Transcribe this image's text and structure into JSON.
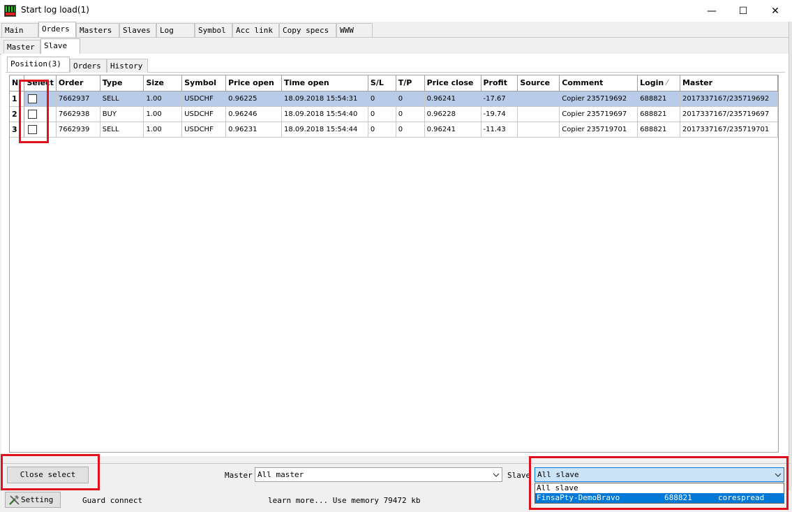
{
  "window": {
    "title": "Start log load(1)",
    "minimize": "—",
    "maximize": "☐",
    "close": "✕"
  },
  "main_tabs": [
    "Main",
    "Orders",
    "Masters",
    "Slaves",
    "Log",
    "Symbol",
    "Acc link",
    "Copy specs",
    "WWW"
  ],
  "sub_tabs": [
    "Master",
    "Slave"
  ],
  "inner_tabs": [
    "Position(3)",
    "Orders",
    "History"
  ],
  "table": {
    "columns": [
      "N",
      "Select",
      "Order",
      "Type",
      "Size",
      "Symbol",
      "Price open",
      "Time open",
      "S/L",
      "T/P",
      "Price close",
      "Profit",
      "Source",
      "Comment",
      "Login",
      "Master"
    ],
    "sort_indicator": "⁄",
    "rows": [
      {
        "n": "1",
        "order": "7662937",
        "type": "SELL",
        "size": "1.00",
        "symbol": "USDCHF",
        "price_open": "0.96225",
        "time_open": "18.09.2018 15:54:31",
        "sl": "0",
        "tp": "0",
        "price_close": "0.96241",
        "profit": "-17.67",
        "source": "",
        "comment": "Copier 235719692",
        "login": "688821",
        "master": "2017337167/235719692"
      },
      {
        "n": "2",
        "order": "7662938",
        "type": "BUY",
        "size": "1.00",
        "symbol": "USDCHF",
        "price_open": "0.96246",
        "time_open": "18.09.2018 15:54:40",
        "sl": "0",
        "tp": "0",
        "price_close": "0.96228",
        "profit": "-19.74",
        "source": "",
        "comment": "Copier 235719697",
        "login": "688821",
        "master": "2017337167/235719697"
      },
      {
        "n": "3",
        "order": "7662939",
        "type": "SELL",
        "size": "1.00",
        "symbol": "USDCHF",
        "price_open": "0.96231",
        "time_open": "18.09.2018 15:54:44",
        "sl": "0",
        "tp": "0",
        "price_close": "0.96241",
        "profit": "-11.43",
        "source": "",
        "comment": "Copier 235719701",
        "login": "688821",
        "master": "2017337167/235719701"
      }
    ]
  },
  "bottom": {
    "close_select": "Close select",
    "master_label": "Master",
    "master_value": "All master",
    "slave_label": "Slave",
    "slave_value": "All slave",
    "dropdown_options": [
      {
        "name": "All slave",
        "login": "",
        "group": ""
      },
      {
        "name": "FinsaPty-DemoBravo",
        "login": "688821",
        "group": "corespread"
      }
    ]
  },
  "status": {
    "setting": "Setting",
    "guard": "Guard connect",
    "info": "learn more... Use memory 79472 kb"
  },
  "icons": [
    "app-icon",
    "chevron-down-icon",
    "settings-tool-icon"
  ]
}
